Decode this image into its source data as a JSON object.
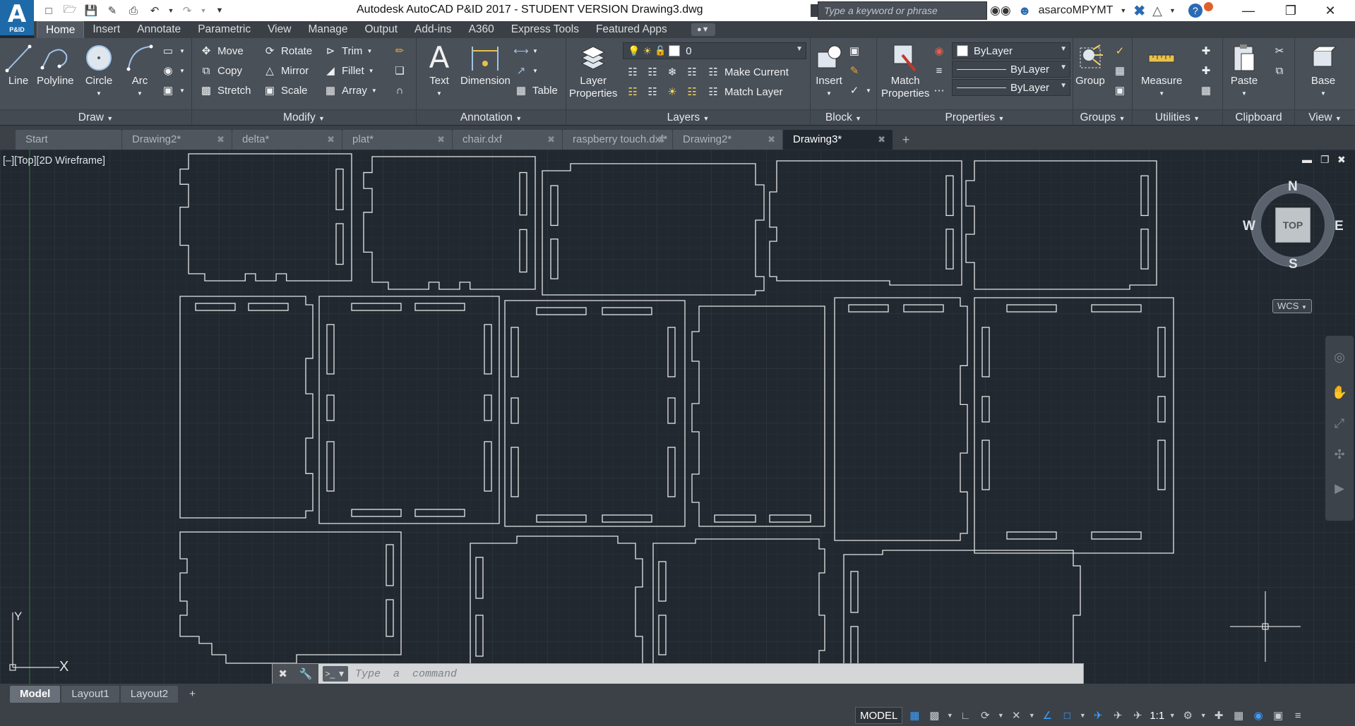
{
  "app": {
    "logo_letter": "A",
    "logo_sub": "P&ID",
    "title": "Autodesk AutoCAD P&ID 2017 - STUDENT VERSION    Drawing3.dwg",
    "search_placeholder": "Type a keyword or phrase",
    "user": "asarcoMPYMT"
  },
  "ribbon_tabs": [
    "Home",
    "Insert",
    "Annotate",
    "Parametric",
    "View",
    "Manage",
    "Output",
    "Add-ins",
    "A360",
    "Express Tools",
    "Featured Apps"
  ],
  "active_ribbon_tab": "Home",
  "panels": {
    "draw": {
      "title": "Draw",
      "line": "Line",
      "polyline": "Polyline",
      "circle": "Circle",
      "arc": "Arc"
    },
    "modify": {
      "title": "Modify",
      "move": "Move",
      "rotate": "Rotate",
      "trim": "Trim",
      "copy": "Copy",
      "mirror": "Mirror",
      "fillet": "Fillet",
      "stretch": "Stretch",
      "scale": "Scale",
      "array": "Array"
    },
    "annotation": {
      "title": "Annotation",
      "text": "Text",
      "dimension": "Dimension",
      "table": "Table"
    },
    "layers": {
      "title": "Layers",
      "layer_properties_1": "Layer",
      "layer_properties_2": "Properties",
      "current_layer": "0",
      "make_current": "Make Current",
      "match_layer": "Match Layer"
    },
    "block": {
      "title": "Block",
      "insert": "Insert"
    },
    "properties": {
      "title": "Properties",
      "match_1": "Match",
      "match_2": "Properties",
      "color": "ByLayer",
      "linetype": "ByLayer",
      "lineweight": "ByLayer"
    },
    "groups": {
      "title": "Groups",
      "group": "Group"
    },
    "utilities": {
      "title": "Utilities",
      "measure": "Measure"
    },
    "clipboard": {
      "title": "Clipboard",
      "paste": "Paste"
    },
    "view": {
      "title": "View",
      "base": "Base"
    }
  },
  "doc_tabs": [
    "Start",
    "Drawing2*",
    "delta*",
    "plat*",
    "chair.dxf",
    "raspberry touch.dxf*",
    "Drawing2*",
    "Drawing3*"
  ],
  "active_doc_tab": "Drawing3*",
  "viewport": {
    "label": "[–][Top][2D Wireframe]",
    "compass": {
      "n": "N",
      "s": "S",
      "e": "E",
      "w": "W",
      "face": "TOP"
    },
    "wcs": "WCS",
    "ucs_x": "X",
    "ucs_y": "Y"
  },
  "command": {
    "placeholder": "Type  a  command"
  },
  "layout_tabs": [
    "Model",
    "Layout1",
    "Layout2"
  ],
  "active_layout_tab": "Model",
  "status": {
    "model": "MODEL",
    "scale": "1:1"
  },
  "colors": {
    "canvas": "#212830",
    "ribbon": "#4a5058",
    "accent": "#1e6aa8",
    "lines": "#e6e6e6"
  }
}
